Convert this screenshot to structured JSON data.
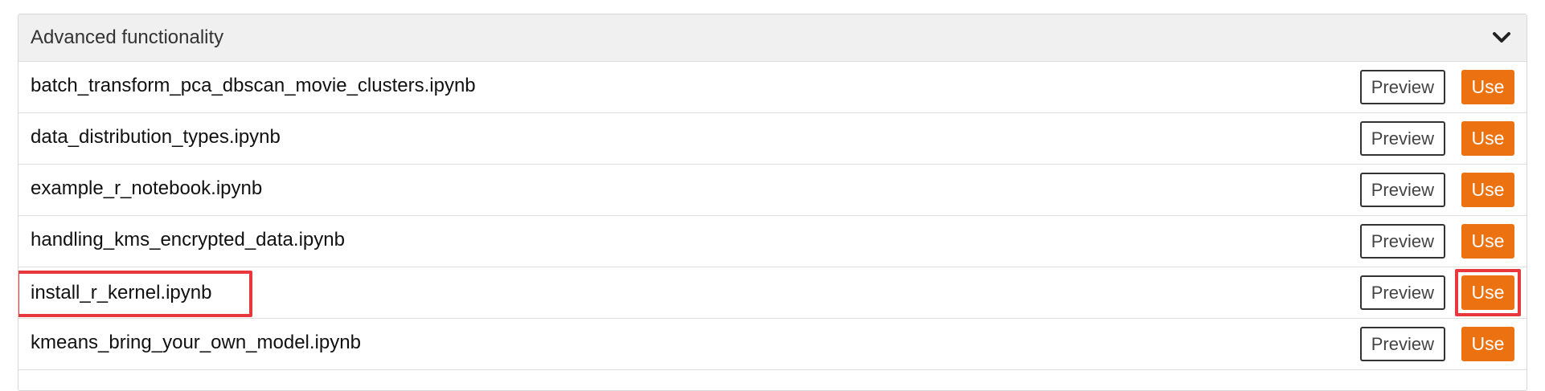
{
  "panel": {
    "title": "Advanced functionality",
    "collapse_icon": "chevron-down-icon"
  },
  "buttons": {
    "preview_label": "Preview",
    "use_label": "Use"
  },
  "colors": {
    "use_button": "#ec7211",
    "highlight": "#e8383d"
  },
  "notebooks": [
    {
      "name": "batch_transform_pca_dbscan_movie_clusters.ipynb",
      "preview": "Preview",
      "use": "Use"
    },
    {
      "name": "data_distribution_types.ipynb",
      "preview": "Preview",
      "use": "Use"
    },
    {
      "name": "example_r_notebook.ipynb",
      "preview": "Preview",
      "use": "Use"
    },
    {
      "name": "handling_kms_encrypted_data.ipynb",
      "preview": "Preview",
      "use": "Use"
    },
    {
      "name": "install_r_kernel.ipynb",
      "preview": "Preview",
      "use": "Use"
    },
    {
      "name": "kmeans_bring_your_own_model.ipynb",
      "preview": "Preview",
      "use": "Use"
    }
  ]
}
